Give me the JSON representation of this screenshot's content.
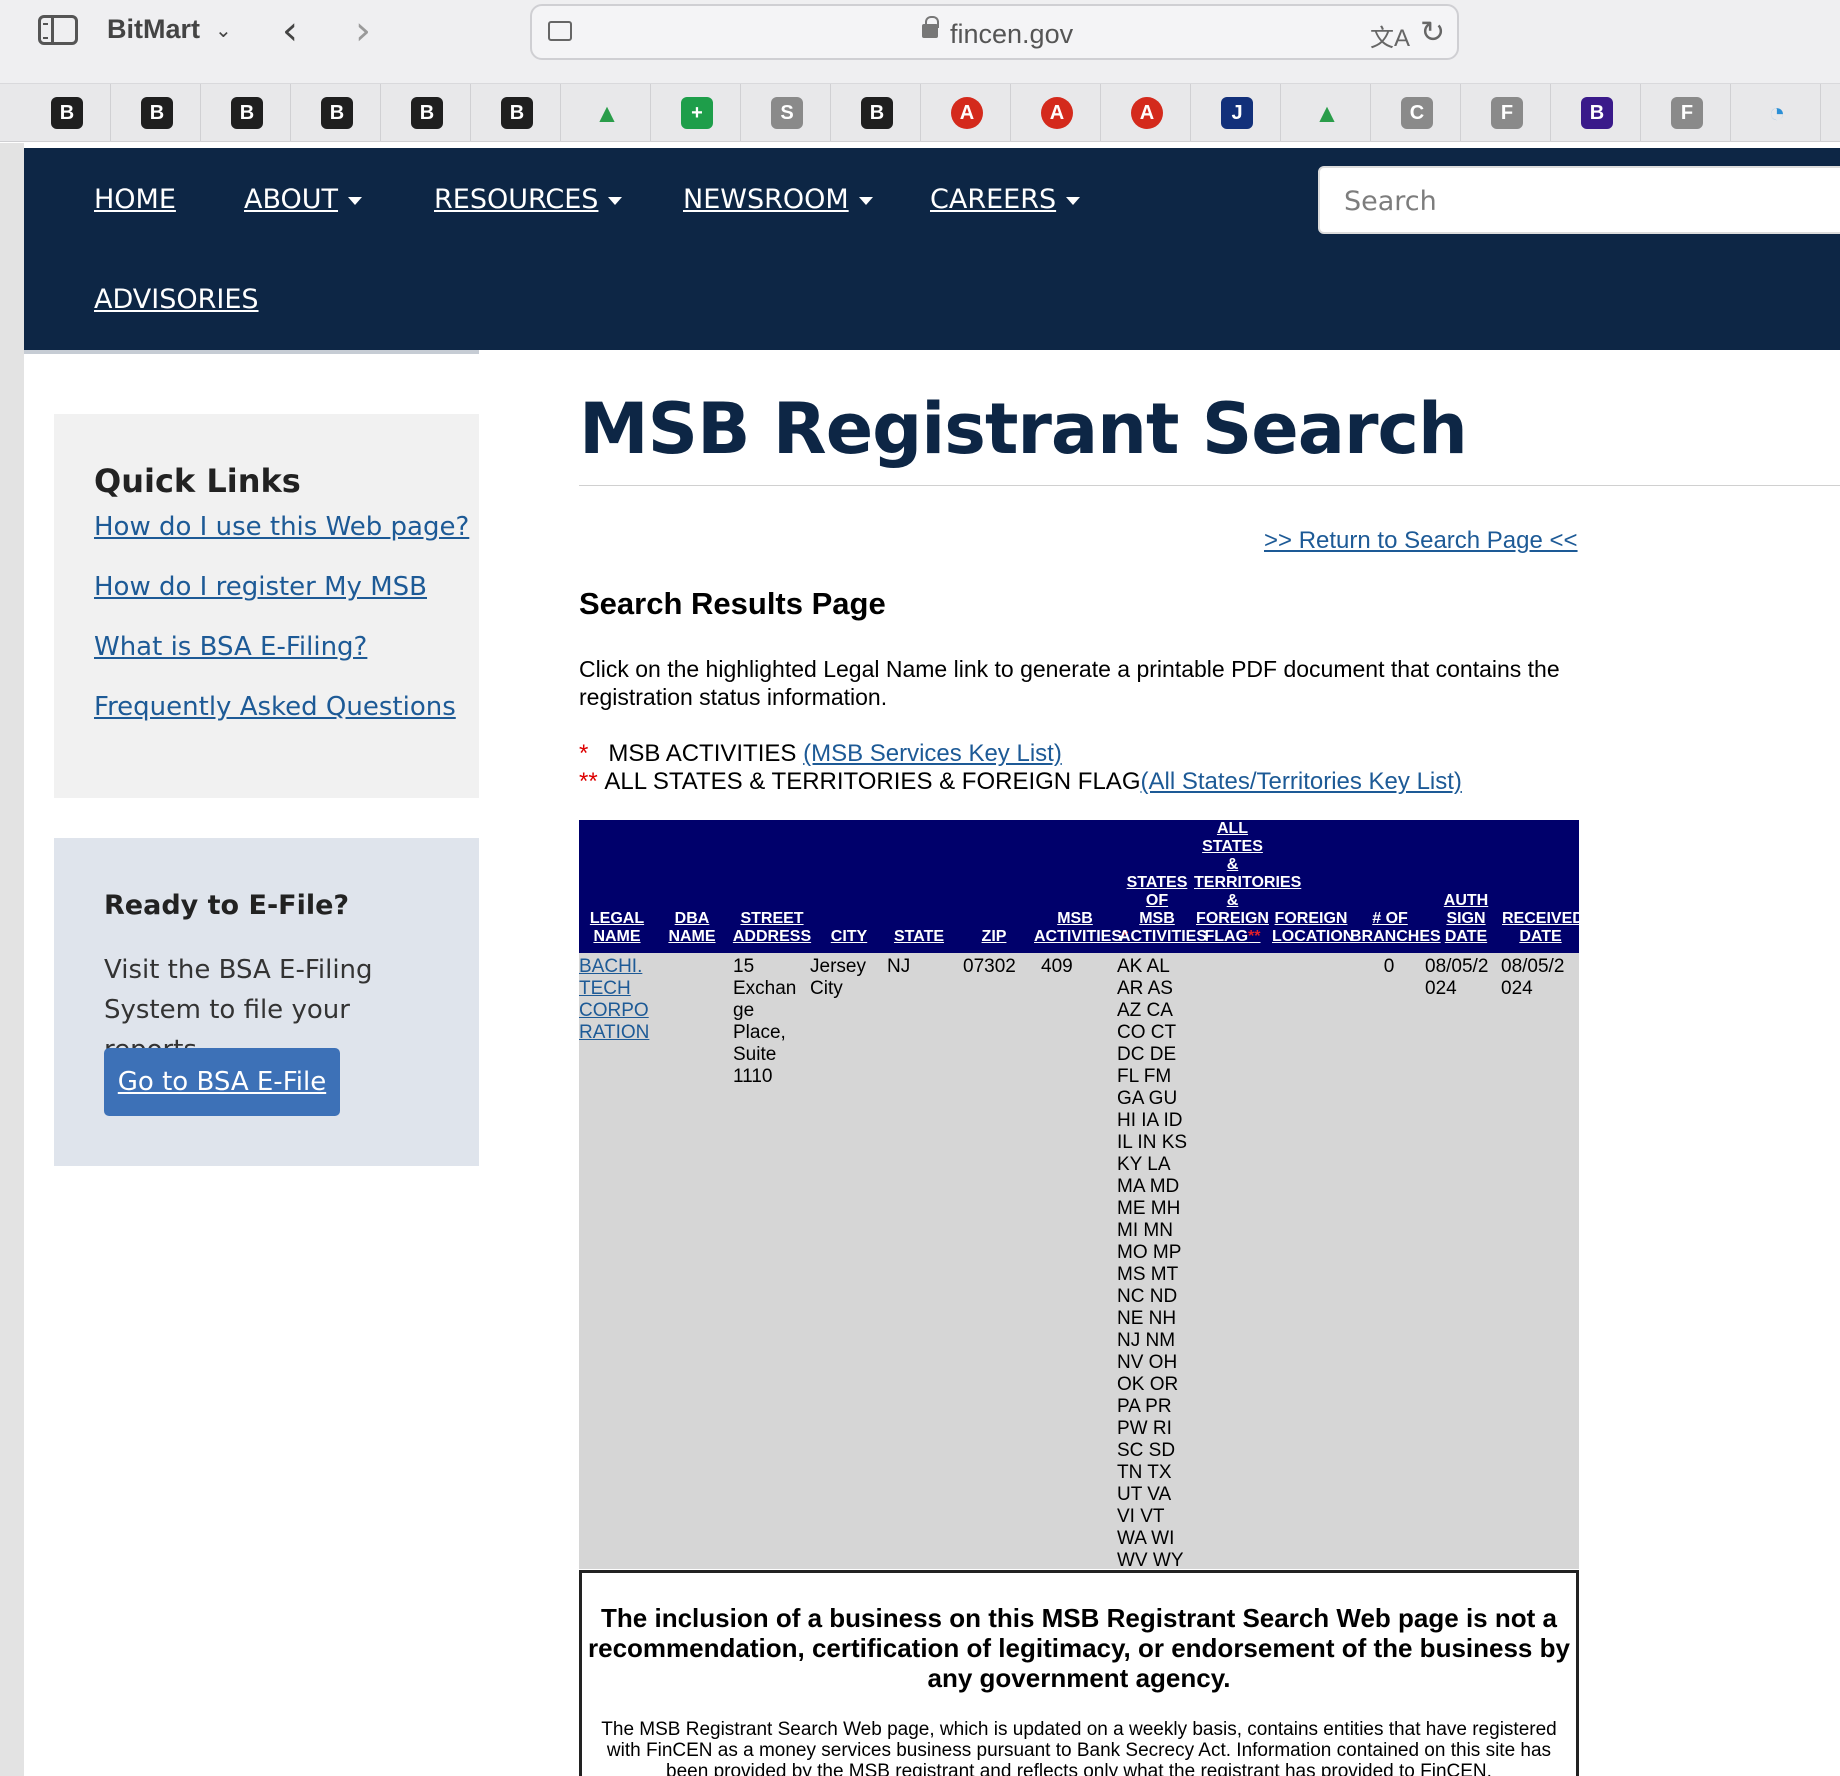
{
  "browser": {
    "profile_name": "BitMart",
    "url": "fincen.gov",
    "bookmarks": [
      {
        "icon": "bitmart-icon",
        "glyph": "B",
        "color": "#1f1f1f"
      },
      {
        "icon": "bitmart-icon",
        "glyph": "B",
        "color": "#1f1f1f"
      },
      {
        "icon": "bitmart-icon",
        "glyph": "B",
        "color": "#1f1f1f"
      },
      {
        "icon": "bitmart-icon",
        "glyph": "B",
        "color": "#1f1f1f"
      },
      {
        "icon": "bitmart-icon",
        "glyph": "B",
        "color": "#1f1f1f"
      },
      {
        "icon": "bitmart-icon",
        "glyph": "B",
        "color": "#1f1f1f"
      },
      {
        "icon": "google-drive-icon",
        "glyph": "▲",
        "color": "#e8e8ea"
      },
      {
        "icon": "google-sheets-plus-icon",
        "glyph": "+",
        "color": "#1e9e4a"
      },
      {
        "icon": "s-letter-icon",
        "glyph": "S",
        "color": "#8a8a8a"
      },
      {
        "icon": "bitmart-icon",
        "glyph": "B",
        "color": "#1f1f1f"
      },
      {
        "icon": "a-circle-icon",
        "glyph": "A",
        "color": "#d42a1c"
      },
      {
        "icon": "a-circle-icon",
        "glyph": "A",
        "color": "#d42a1c"
      },
      {
        "icon": "a-circle-icon",
        "glyph": "A",
        "color": "#d42a1c"
      },
      {
        "icon": "j-letter-icon",
        "glyph": "J",
        "color": "#12307a"
      },
      {
        "icon": "google-drive-icon",
        "glyph": "▲",
        "color": "#e8e8ea"
      },
      {
        "icon": "c-letter-icon",
        "glyph": "C",
        "color": "#8a8a8a"
      },
      {
        "icon": "f-letter-icon",
        "glyph": "F",
        "color": "#8a8a8a"
      },
      {
        "icon": "b-purple-icon",
        "glyph": "B",
        "color": "#3a1a8a"
      },
      {
        "icon": "f-letter-icon",
        "glyph": "F",
        "color": "#8a8a8a"
      },
      {
        "icon": "spiral-logo-icon",
        "glyph": "◔",
        "color": "#e8e8ea"
      }
    ]
  },
  "nav": {
    "home": "HOME",
    "about": "ABOUT",
    "resources": "RESOURCES",
    "newsroom": "NEWSROOM",
    "careers": "CAREERS",
    "advisories": "ADVISORIES",
    "search_placeholder": "Search"
  },
  "quick_links": {
    "title": "Quick Links",
    "links": [
      "How do I use this Web page?",
      "How do I register My MSB",
      "What is BSA E-Filing?",
      "Frequently Asked Questions"
    ]
  },
  "efile": {
    "title": "Ready to E-File?",
    "text": "Visit the BSA E-Filing System to file your reports.",
    "button": "Go to BSA E-File"
  },
  "main": {
    "title": "MSB Registrant Search",
    "return_link": ">> Return to Search Page <<",
    "results_heading": "Search Results Page",
    "intro": "Click on the highlighted Legal Name link to generate a printable PDF document that contains the registration status information.",
    "key1_marker": "*",
    "key1_text": "MSB ACTIVITIES",
    "key1_link": "(MSB Services Key List)",
    "key2_marker": "**",
    "key2_text": "ALL STATES & TERRITORIES & FOREIGN FLAG",
    "key2_link": "(All States/Territories Key List)"
  },
  "table": {
    "headers": {
      "legal_name": "LEGAL\nNAME",
      "dba_name": "DBA\nNAME",
      "street": "STREET\nADDRESS",
      "city": "CITY",
      "state": "STATE",
      "zip": "ZIP",
      "msb_activities": "MSB\nACTIVITIES",
      "msb_activities_mark": "*",
      "states_of_msb": "STATES\nOF\nMSB\nACTIVITIES",
      "all_states": "ALL\nSTATES\n&\nTERRITORIES\n&\nFOREIGN\nFLAG",
      "all_states_mark": "**",
      "foreign_location": "FOREIGN\nLOCATION",
      "branches": "# OF\nBRANCHES",
      "auth_sign_date": "AUTH\nSIGN\nDATE",
      "received_date": "RECEIVED\nDATE"
    },
    "row": {
      "legal_name": "BACHI.\nTECH\nCORPO\nRATION",
      "dba_name": "",
      "street": "15\nExchan\nge\nPlace,\nSuite\n1110",
      "city": "Jersey\nCity",
      "state": "NJ",
      "zip": "07302",
      "msb_activities": "409",
      "states_of_msb": "AK AL\nAR AS\nAZ CA\nCO CT\nDC DE\nFL FM\nGA GU\nHI IA ID\nIL IN KS\nKY LA\nMA MD\nME MH\nMI MN\nMO MP\nMS MT\nNC ND\nNE NH\nNJ NM\nNV OH\nOK OR\nPA PR\nPW RI\nSC SD\nTN TX\nUT VA\nVI VT\nWA WI\nWV WY",
      "all_states": "",
      "foreign_location": "",
      "branches": "0",
      "auth_sign_date": "08/05/2\n024",
      "received_date": "08/05/2\n024"
    }
  },
  "disclaimer": {
    "bold": "The inclusion of a business on this MSB Registrant Search Web page is not a recommendation, certification of legitimacy, or endorsement of the business by any government agency.",
    "text": "The MSB Registrant Search Web page, which is updated on a weekly basis, contains entities that have registered with FinCEN as a money services business pursuant to Bank Secrecy Act. Information contained on this site has been provided by the MSB registrant and reflects only what the registrant has provided to FinCEN."
  }
}
